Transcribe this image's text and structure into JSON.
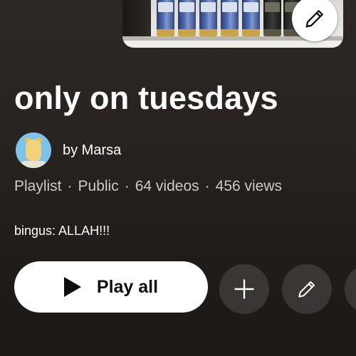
{
  "playlist": {
    "title": "only on tuesdays",
    "owner": "by Marsa",
    "meta": {
      "type": "Playlist",
      "visibility": "Public",
      "videos": "64 videos",
      "views": "456 views"
    },
    "description": "bingus: ALLAH!!!"
  },
  "actions": {
    "play_all_label": "Play all",
    "add_icon": "plus-icon",
    "edit_icon": "pencil-icon",
    "more_icon": "share-icon"
  },
  "thumbnail": {
    "edit_icon": "pencil-icon"
  },
  "colors": {
    "background": "#231e1b",
    "primary_text": "#ffffff",
    "secondary_text": "#cfcac6",
    "button_bg": "#ffffff",
    "circle_button_bg": "rgba(255,255,255,0.12)"
  }
}
